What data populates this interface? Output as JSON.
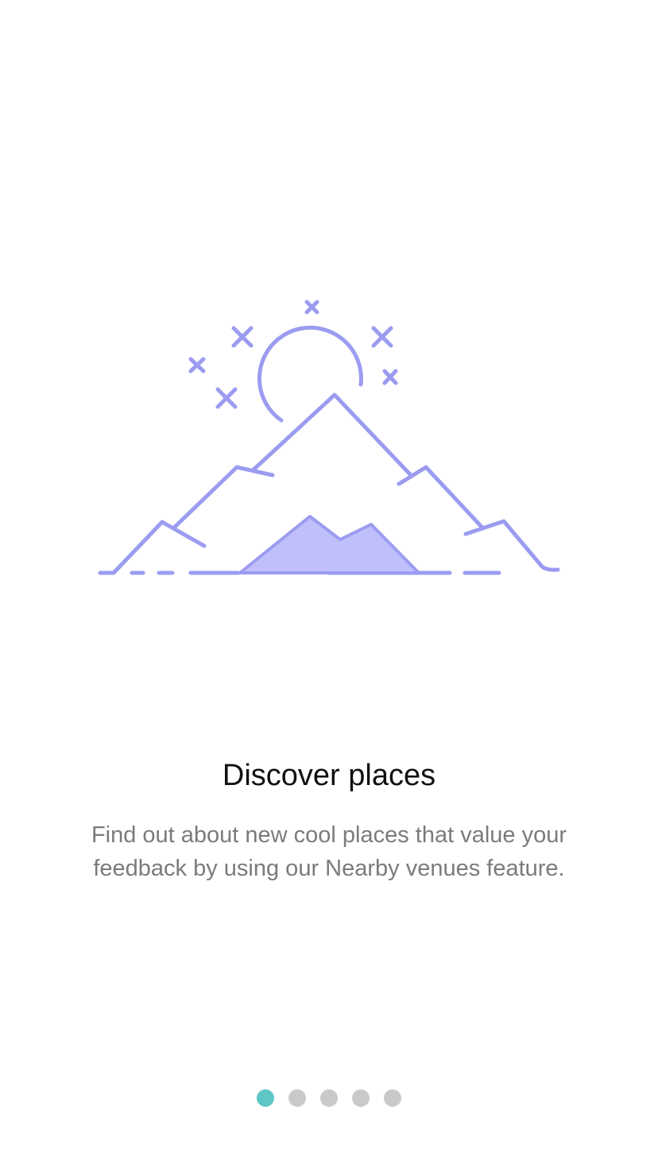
{
  "onboarding": {
    "illustration_icon": "mountains-moon-icon",
    "title": "Discover places",
    "description": "Find out about new cool places that value your feedback by using our Nearby venues feature."
  },
  "pager": {
    "total_pages": 5,
    "active_index": 0,
    "active_color": "#5ec7c6",
    "inactive_color": "#c9c9c9"
  },
  "colors": {
    "illustration_stroke": "#9b9cf0",
    "illustration_fill": "#bfc0fb"
  }
}
